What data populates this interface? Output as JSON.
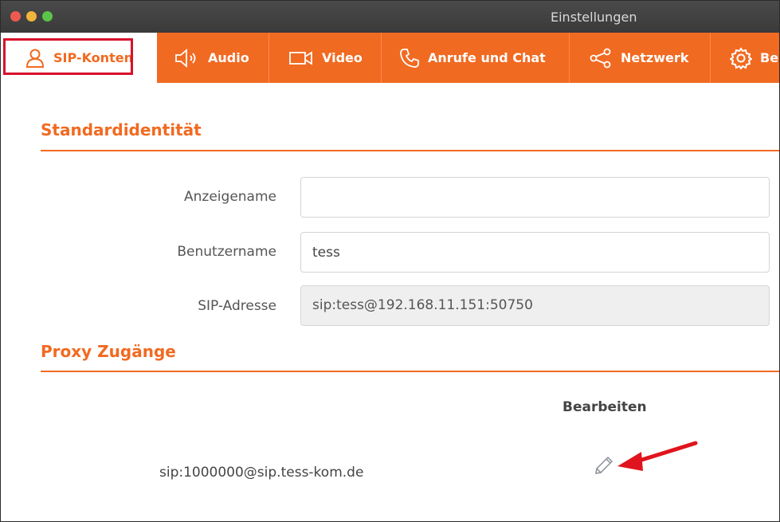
{
  "window": {
    "title": "Einstellungen"
  },
  "tabs": [
    {
      "label": "SIP-Konten",
      "icon": "user-icon",
      "active": true
    },
    {
      "label": "Audio",
      "icon": "speaker-icon"
    },
    {
      "label": "Video",
      "icon": "video-camera-icon"
    },
    {
      "label": "Anrufe und Chat",
      "icon": "phone-icon"
    },
    {
      "label": "Netzwerk",
      "icon": "share-network-icon"
    },
    {
      "label": "Be",
      "icon": "gear-icon"
    }
  ],
  "standard_identity": {
    "title": "Standardidentität",
    "display_name": {
      "label": "Anzeigename",
      "value": ""
    },
    "username": {
      "label": "Benutzername",
      "value": "tess"
    },
    "sip_address": {
      "label": "SIP-Adresse",
      "value": "sip:tess@192.168.11.151:50750"
    }
  },
  "proxy": {
    "title": "Proxy Zugänge",
    "edit_header": "Bearbeiten",
    "accounts": [
      {
        "address": "sip:1000000@sip.tess-kom.de"
      }
    ]
  },
  "colors": {
    "accent": "#f16a21",
    "highlight": "#d8102b",
    "annotation_arrow": "#e0141e"
  }
}
